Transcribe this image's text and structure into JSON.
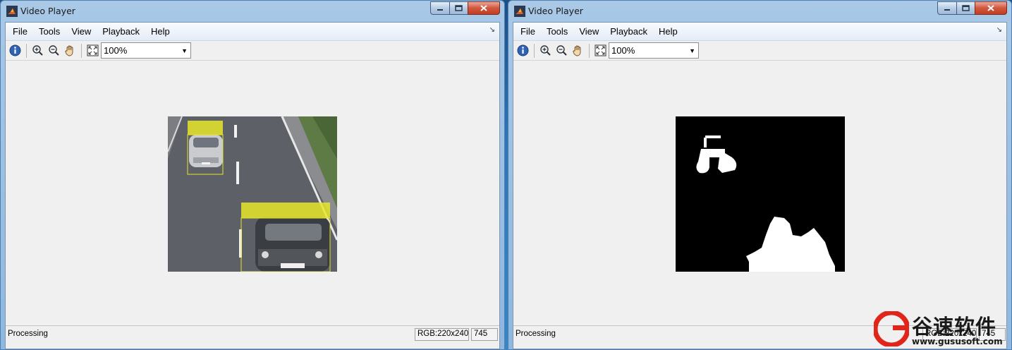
{
  "left_window": {
    "title": "Video Player",
    "menu": [
      "File",
      "Tools",
      "View",
      "Playback",
      "Help"
    ],
    "zoom_value": "100%",
    "status_text": "Processing",
    "status_rgb": "RGB:220x240",
    "status_frame": "745"
  },
  "right_window": {
    "title": "Video Player",
    "menu": [
      "File",
      "Tools",
      "View",
      "Playback",
      "Help"
    ],
    "zoom_value": "100%",
    "status_text": "Processing",
    "status_rgb": "RGB:220x240",
    "status_frame": "745"
  },
  "watermark": {
    "name": "谷速软件",
    "url": "www.gususoft.com"
  },
  "colors": {
    "detection_box": "#e8e62a",
    "road": "#5d6066",
    "mask_foreground": "#ffffff",
    "mask_background": "#000000",
    "close_button": "#c94a30"
  },
  "icons": [
    "info-icon",
    "zoom-in-icon",
    "zoom-out-icon",
    "pan-hand-icon",
    "fit-to-window-icon",
    "dropdown-arrow-icon",
    "matlab-icon"
  ]
}
